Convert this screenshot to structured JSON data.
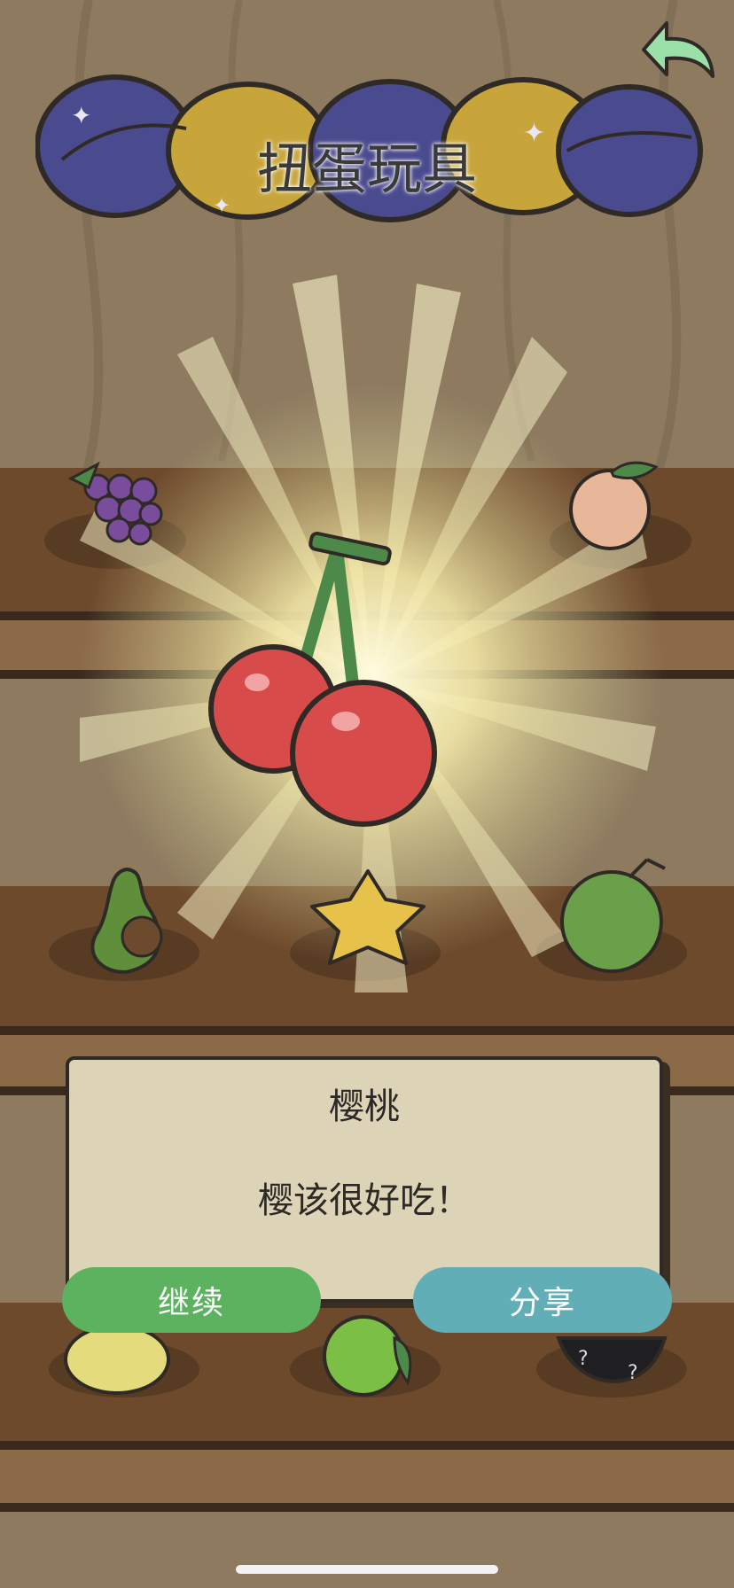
{
  "header": {
    "title": "扭蛋玩具",
    "back_icon": "back-arrow-icon"
  },
  "reward": {
    "item_name": "樱桃",
    "icon": "cherry-icon"
  },
  "dialog": {
    "title": "樱桃",
    "message": "樱该很好吃！"
  },
  "buttons": {
    "continue_label": "继续",
    "share_label": "分享"
  },
  "shelf_items": [
    "grapes-icon",
    "peach-icon",
    "avocado-icon",
    "starfruit-icon",
    "coconut-icon",
    "lemon-icon",
    "lime-icon",
    "mystery-fruit-icon"
  ],
  "colors": {
    "continue": "#5cb25f",
    "share": "#62aeb7",
    "capsule_blue": "#4a4a8f",
    "capsule_yellow": "#c8a53a",
    "back_arrow": "#9be0a8"
  }
}
